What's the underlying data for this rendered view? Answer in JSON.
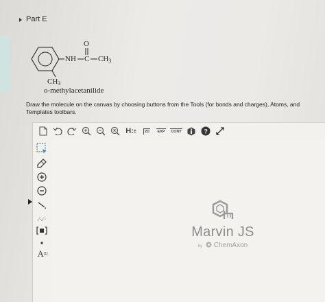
{
  "part": {
    "title": "Part E"
  },
  "molecule": {
    "nh": "NH",
    "c": "C",
    "o": "O",
    "ch3_right": "CH",
    "ch3_right_sub": "3",
    "ch3_ortho": "CH",
    "ch3_ortho_sub": "3"
  },
  "compound_name": "o-methylacetanilide",
  "instructions": "Draw the molecule on the canvas by choosing buttons from the Tools (for bonds and charges), Atoms, and Templates toolbars.",
  "toolbar_top": {
    "h_label": "H:",
    "h_sup": "±",
    "tool_2d": "2D",
    "tool_exp": "EXP",
    "tool_cont": "CONT"
  },
  "toolbar_left": {
    "atom_label": "A",
    "atom_sup": "[1]"
  },
  "watermark": {
    "title": "Marvin JS",
    "by": "by",
    "company": "ChemAxon"
  },
  "colors": {
    "accent_left": "#cfe3e1",
    "canvas_bg": "#f3f2ef",
    "select_blue": "#4a7fc0"
  }
}
